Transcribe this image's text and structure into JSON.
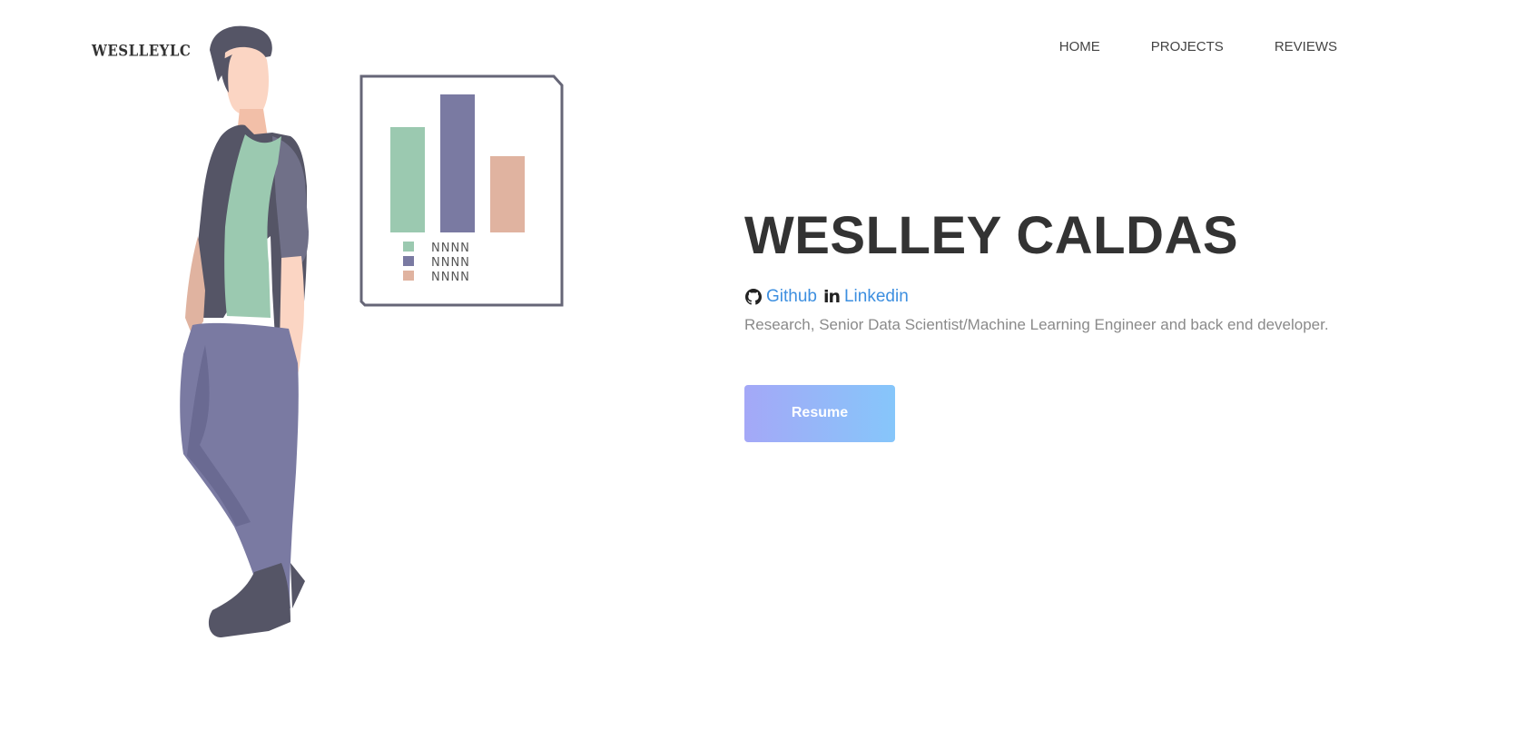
{
  "brand": {
    "logo": "WESLLEYLC"
  },
  "nav": {
    "items": [
      {
        "label": "HOME"
      },
      {
        "label": "PROJECTS"
      },
      {
        "label": "REVIEWS"
      }
    ]
  },
  "hero": {
    "title": "WESLLEY CALDAS",
    "links": {
      "github_label": "Github",
      "linkedin_icon": "in",
      "linkedin_label": "Linkedin"
    },
    "tagline": "Research, Senior Data Scientist/Machine Learning Engineer and back end developer.",
    "resume_label": "Resume"
  },
  "illustration": {
    "chart_bars": [
      0.7,
      1.0,
      0.55
    ],
    "legend_text": "NNNN"
  },
  "colors": {
    "green": "#9bc9b0",
    "purple": "#7a7aa2",
    "peach": "#e0b3a0",
    "link": "#3d8fe0",
    "title": "#333333"
  }
}
